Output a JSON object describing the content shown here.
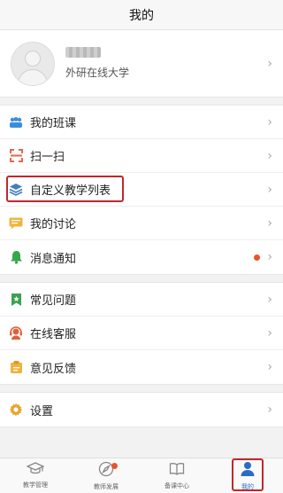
{
  "header": {
    "title": "我的"
  },
  "profile": {
    "school": "外研在线大学",
    "chevron": "›"
  },
  "menu": {
    "group1": [
      {
        "label": "我的班课",
        "icon": "people-icon",
        "color": "#3b8fd8"
      },
      {
        "label": "扫一扫",
        "icon": "scan-icon",
        "color": "#e06a4e"
      },
      {
        "label": "自定义教学列表",
        "icon": "layers-icon",
        "color": "#3f7fbf"
      },
      {
        "label": "我的讨论",
        "icon": "chat-icon",
        "color": "#f0b43c"
      },
      {
        "label": "消息通知",
        "icon": "bell-icon",
        "color": "#39a64a"
      }
    ],
    "group2": [
      {
        "label": "常见问题",
        "icon": "bookmark-icon",
        "color": "#3ba24f"
      },
      {
        "label": "在线客服",
        "icon": "headset-icon",
        "color": "#e0613a"
      },
      {
        "label": "意见反馈",
        "icon": "feedback-icon",
        "color": "#f0b43c"
      }
    ],
    "group3": [
      {
        "label": "设置",
        "icon": "gear-icon",
        "color": "#e8a52a"
      }
    ],
    "chevron": "›"
  },
  "tabbar": {
    "items": [
      {
        "label": "教学管理",
        "icon": "graduation-cap-icon"
      },
      {
        "label": "教师发展",
        "icon": "compass-icon"
      },
      {
        "label": "备课中心",
        "icon": "book-icon"
      },
      {
        "label": "我的",
        "icon": "user-icon",
        "active": true
      }
    ]
  }
}
